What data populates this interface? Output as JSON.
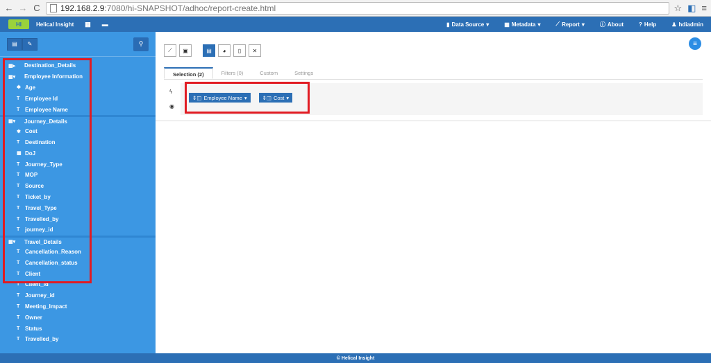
{
  "browser": {
    "url_host": "192.168.2.9",
    "url_path": ":7080/hi-SNAPSHOT/adhoc/report-create.html"
  },
  "app": {
    "logo_text": "HI",
    "brand": "Helical Insight",
    "menu": [
      {
        "label": "Data Source",
        "icon": "database-icon"
      },
      {
        "label": "Metadata",
        "icon": "table-icon"
      },
      {
        "label": "Report",
        "icon": "line-chart-icon"
      },
      {
        "label": "About",
        "icon": "info-icon"
      },
      {
        "label": "Help",
        "icon": "question-icon"
      },
      {
        "label": "hdiadmin",
        "icon": "user-icon"
      }
    ]
  },
  "sidebar": {
    "tree": [
      {
        "type": "folder",
        "label": "Destination_Details",
        "icon": "table-caret-right-icon"
      },
      {
        "type": "folder",
        "label": "Employee Information",
        "icon": "table-caret-down-icon"
      },
      {
        "type": "leaf",
        "label": "Age",
        "icon": "asterisk-icon"
      },
      {
        "type": "leaf",
        "label": "Employee Id",
        "icon": "text-icon"
      },
      {
        "type": "leaf",
        "label": "Employee Name",
        "icon": "text-icon"
      },
      {
        "type": "folder",
        "label": "Journey_Details",
        "icon": "table-caret-down-icon",
        "sep": true
      },
      {
        "type": "leaf",
        "label": "Cost",
        "icon": "asterisk-icon"
      },
      {
        "type": "leaf",
        "label": "Destination",
        "icon": "text-icon"
      },
      {
        "type": "leaf",
        "label": "DoJ",
        "icon": "calendar-icon"
      },
      {
        "type": "leaf",
        "label": "Journey_Type",
        "icon": "text-icon"
      },
      {
        "type": "leaf",
        "label": "MOP",
        "icon": "text-icon"
      },
      {
        "type": "leaf",
        "label": "Source",
        "icon": "text-icon"
      },
      {
        "type": "leaf",
        "label": "Ticket_by",
        "icon": "text-icon"
      },
      {
        "type": "leaf",
        "label": "Travel_Type",
        "icon": "text-icon"
      },
      {
        "type": "leaf",
        "label": "Travelled_by",
        "icon": "text-icon"
      },
      {
        "type": "leaf",
        "label": "journey_id",
        "icon": "text-icon"
      },
      {
        "type": "folder",
        "label": "Travel_Details",
        "icon": "table-caret-down-icon",
        "sep": true
      },
      {
        "type": "leaf",
        "label": "Cancellation_Reason",
        "icon": "text-icon"
      },
      {
        "type": "leaf",
        "label": "Cancellation_status",
        "icon": "text-icon"
      },
      {
        "type": "leaf",
        "label": "Client",
        "icon": "text-icon"
      },
      {
        "type": "leaf",
        "label": "Client_id",
        "icon": "text-icon"
      },
      {
        "type": "leaf",
        "label": "Journey_id",
        "icon": "text-icon"
      },
      {
        "type": "leaf",
        "label": "Meeting_Impact",
        "icon": "text-icon"
      },
      {
        "type": "leaf",
        "label": "Owner",
        "icon": "text-icon"
      },
      {
        "type": "leaf",
        "label": "Status",
        "icon": "text-icon"
      },
      {
        "type": "leaf",
        "label": "Travelled_by",
        "icon": "text-icon"
      }
    ]
  },
  "tabs": [
    {
      "label": "Selection (2)",
      "active": true
    },
    {
      "label": "Filters (0)",
      "active": false
    },
    {
      "label": "Custom",
      "active": false
    },
    {
      "label": "Settings",
      "active": false
    }
  ],
  "selection": {
    "chips": [
      {
        "label": "Employee Name"
      },
      {
        "label": "Cost"
      }
    ]
  },
  "footer": {
    "text": "© Helical Insight"
  },
  "colors": {
    "header": "#2c6fb5",
    "sidebar": "#3c97e3",
    "highlight": "#e11b22"
  }
}
